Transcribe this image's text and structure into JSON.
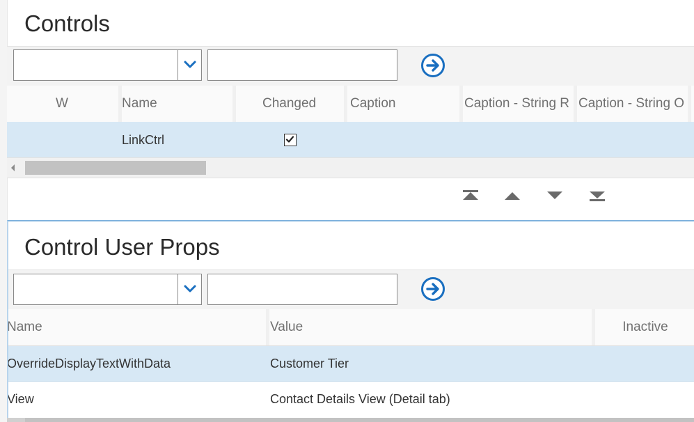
{
  "controls": {
    "title": "Controls",
    "filter": {
      "field_value": "",
      "query_value": ""
    },
    "columns": [
      "W",
      "Name",
      "Changed",
      "Caption",
      "Caption - String R",
      "Caption - String O"
    ],
    "rows": [
      {
        "w": "",
        "name": "LinkCtrl",
        "changed": true,
        "caption": "",
        "caption_string_r": "",
        "caption_string_o": ""
      }
    ],
    "nav": {
      "first": "move-first-icon",
      "up": "move-up-icon",
      "down": "move-down-icon",
      "last": "move-last-icon"
    }
  },
  "control_user_props": {
    "title": "Control User Props",
    "filter": {
      "field_value": "",
      "query_value": ""
    },
    "columns": [
      "Name",
      "Value",
      "Inactive"
    ],
    "rows": [
      {
        "name": "OverrideDisplayTextWithData",
        "value": "Customer Tier",
        "inactive": ""
      },
      {
        "name": "View",
        "value": "Contact Details View (Detail tab)",
        "inactive": ""
      }
    ]
  },
  "colors": {
    "accent": "#1a6fc0",
    "selected_row": "#d7e8f5",
    "toolbar_bg": "#f3f3f3",
    "header_text": "#707070"
  }
}
